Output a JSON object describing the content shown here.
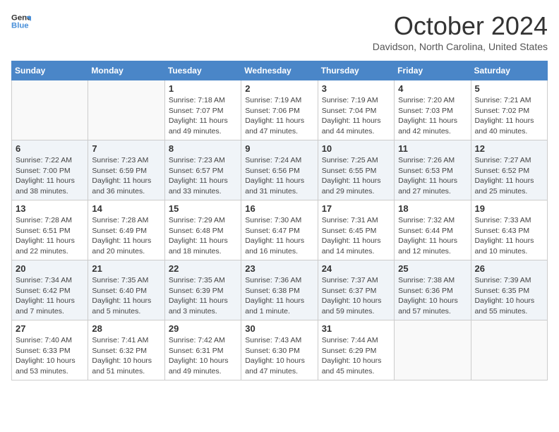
{
  "header": {
    "logo_line1": "General",
    "logo_line2": "Blue",
    "month": "October 2024",
    "location": "Davidson, North Carolina, United States"
  },
  "days_of_week": [
    "Sunday",
    "Monday",
    "Tuesday",
    "Wednesday",
    "Thursday",
    "Friday",
    "Saturday"
  ],
  "weeks": [
    [
      {
        "day": "",
        "info": ""
      },
      {
        "day": "",
        "info": ""
      },
      {
        "day": "1",
        "info": "Sunrise: 7:18 AM\nSunset: 7:07 PM\nDaylight: 11 hours and 49 minutes."
      },
      {
        "day": "2",
        "info": "Sunrise: 7:19 AM\nSunset: 7:06 PM\nDaylight: 11 hours and 47 minutes."
      },
      {
        "day": "3",
        "info": "Sunrise: 7:19 AM\nSunset: 7:04 PM\nDaylight: 11 hours and 44 minutes."
      },
      {
        "day": "4",
        "info": "Sunrise: 7:20 AM\nSunset: 7:03 PM\nDaylight: 11 hours and 42 minutes."
      },
      {
        "day": "5",
        "info": "Sunrise: 7:21 AM\nSunset: 7:02 PM\nDaylight: 11 hours and 40 minutes."
      }
    ],
    [
      {
        "day": "6",
        "info": "Sunrise: 7:22 AM\nSunset: 7:00 PM\nDaylight: 11 hours and 38 minutes."
      },
      {
        "day": "7",
        "info": "Sunrise: 7:23 AM\nSunset: 6:59 PM\nDaylight: 11 hours and 36 minutes."
      },
      {
        "day": "8",
        "info": "Sunrise: 7:23 AM\nSunset: 6:57 PM\nDaylight: 11 hours and 33 minutes."
      },
      {
        "day": "9",
        "info": "Sunrise: 7:24 AM\nSunset: 6:56 PM\nDaylight: 11 hours and 31 minutes."
      },
      {
        "day": "10",
        "info": "Sunrise: 7:25 AM\nSunset: 6:55 PM\nDaylight: 11 hours and 29 minutes."
      },
      {
        "day": "11",
        "info": "Sunrise: 7:26 AM\nSunset: 6:53 PM\nDaylight: 11 hours and 27 minutes."
      },
      {
        "day": "12",
        "info": "Sunrise: 7:27 AM\nSunset: 6:52 PM\nDaylight: 11 hours and 25 minutes."
      }
    ],
    [
      {
        "day": "13",
        "info": "Sunrise: 7:28 AM\nSunset: 6:51 PM\nDaylight: 11 hours and 22 minutes."
      },
      {
        "day": "14",
        "info": "Sunrise: 7:28 AM\nSunset: 6:49 PM\nDaylight: 11 hours and 20 minutes."
      },
      {
        "day": "15",
        "info": "Sunrise: 7:29 AM\nSunset: 6:48 PM\nDaylight: 11 hours and 18 minutes."
      },
      {
        "day": "16",
        "info": "Sunrise: 7:30 AM\nSunset: 6:47 PM\nDaylight: 11 hours and 16 minutes."
      },
      {
        "day": "17",
        "info": "Sunrise: 7:31 AM\nSunset: 6:45 PM\nDaylight: 11 hours and 14 minutes."
      },
      {
        "day": "18",
        "info": "Sunrise: 7:32 AM\nSunset: 6:44 PM\nDaylight: 11 hours and 12 minutes."
      },
      {
        "day": "19",
        "info": "Sunrise: 7:33 AM\nSunset: 6:43 PM\nDaylight: 11 hours and 10 minutes."
      }
    ],
    [
      {
        "day": "20",
        "info": "Sunrise: 7:34 AM\nSunset: 6:42 PM\nDaylight: 11 hours and 7 minutes."
      },
      {
        "day": "21",
        "info": "Sunrise: 7:35 AM\nSunset: 6:40 PM\nDaylight: 11 hours and 5 minutes."
      },
      {
        "day": "22",
        "info": "Sunrise: 7:35 AM\nSunset: 6:39 PM\nDaylight: 11 hours and 3 minutes."
      },
      {
        "day": "23",
        "info": "Sunrise: 7:36 AM\nSunset: 6:38 PM\nDaylight: 11 hours and 1 minute."
      },
      {
        "day": "24",
        "info": "Sunrise: 7:37 AM\nSunset: 6:37 PM\nDaylight: 10 hours and 59 minutes."
      },
      {
        "day": "25",
        "info": "Sunrise: 7:38 AM\nSunset: 6:36 PM\nDaylight: 10 hours and 57 minutes."
      },
      {
        "day": "26",
        "info": "Sunrise: 7:39 AM\nSunset: 6:35 PM\nDaylight: 10 hours and 55 minutes."
      }
    ],
    [
      {
        "day": "27",
        "info": "Sunrise: 7:40 AM\nSunset: 6:33 PM\nDaylight: 10 hours and 53 minutes."
      },
      {
        "day": "28",
        "info": "Sunrise: 7:41 AM\nSunset: 6:32 PM\nDaylight: 10 hours and 51 minutes."
      },
      {
        "day": "29",
        "info": "Sunrise: 7:42 AM\nSunset: 6:31 PM\nDaylight: 10 hours and 49 minutes."
      },
      {
        "day": "30",
        "info": "Sunrise: 7:43 AM\nSunset: 6:30 PM\nDaylight: 10 hours and 47 minutes."
      },
      {
        "day": "31",
        "info": "Sunrise: 7:44 AM\nSunset: 6:29 PM\nDaylight: 10 hours and 45 minutes."
      },
      {
        "day": "",
        "info": ""
      },
      {
        "day": "",
        "info": ""
      }
    ]
  ]
}
